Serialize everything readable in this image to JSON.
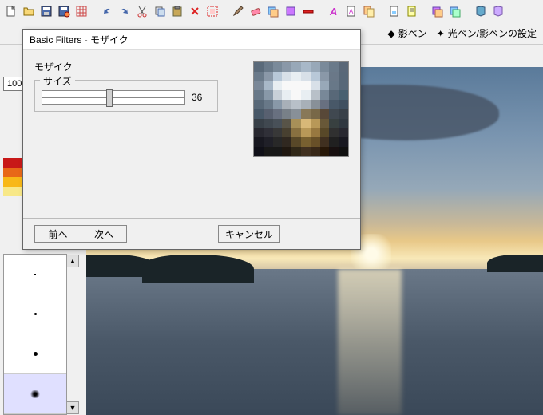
{
  "toolbar": {
    "icons": [
      "new",
      "open",
      "save",
      "save-as",
      "grid",
      "undo",
      "redo",
      "cut",
      "copy",
      "paste",
      "delete",
      "select-all",
      "brush",
      "eraser",
      "layers",
      "pick",
      "opts",
      "text-a",
      "text-outline",
      "dup",
      "doc-a",
      "doc-b",
      "pal-a",
      "pal-b",
      "help",
      "about"
    ]
  },
  "subbar": {
    "shadow_pen": "影ペン",
    "light_pen": "光ペン/影ペンの設定"
  },
  "zoom": {
    "value": "100"
  },
  "palette": [
    "#c81818",
    "#e86818",
    "#f8b818",
    "#f8e888"
  ],
  "dialog": {
    "title": "Basic Filters - モザイク",
    "label": "モザイク",
    "size_label": "サイズ",
    "size_value": "36",
    "prev": "前へ",
    "next": "次へ",
    "cancel": "キャンセル"
  },
  "preview_pixels": [
    "#5a6a7a",
    "#6a7a8a",
    "#7a8a9a",
    "#8a98a8",
    "#98a8b8",
    "#a8b8c8",
    "#98a8b8",
    "#7a8a9a",
    "#6a7a8a",
    "#5a6878",
    "#6a7a8a",
    "#8a98a8",
    "#b8c8d8",
    "#d8e0e8",
    "#e8eef2",
    "#d8e0e8",
    "#b8c8d8",
    "#8a98a8",
    "#6a7888",
    "#586878",
    "#7a8898",
    "#a8b8c8",
    "#e8eef2",
    "#f8f8f8",
    "#f8f8f8",
    "#f8f8f8",
    "#d8e0e8",
    "#98a8b8",
    "#687888",
    "#586878",
    "#687888",
    "#8898a8",
    "#c8d0d8",
    "#e8eef2",
    "#f8f8f8",
    "#e8eef2",
    "#b8c0c8",
    "#788898",
    "#586878",
    "#486070",
    "#586878",
    "#687888",
    "#8898a8",
    "#a8b0b8",
    "#b8c0c8",
    "#a8b0b8",
    "#889098",
    "#687080",
    "#485868",
    "#405060",
    "#485868",
    "#586070",
    "#687080",
    "#788088",
    "#889098",
    "#887858",
    "#786848",
    "#584838",
    "#404850",
    "#384048",
    "#384048",
    "#404850",
    "#485058",
    "#585448",
    "#a89058",
    "#d8b878",
    "#b89858",
    "#685838",
    "#384040",
    "#303840",
    "#282830",
    "#303038",
    "#383838",
    "#484030",
    "#887040",
    "#b89858",
    "#987840",
    "#584828",
    "#303030",
    "#282830",
    "#181820",
    "#202028",
    "#282828",
    "#302820",
    "#584828",
    "#786030",
    "#685028",
    "#403020",
    "#202020",
    "#181820",
    "#101018",
    "#181818",
    "#181818",
    "#201810",
    "#302818",
    "#403020",
    "#382818",
    "#281808",
    "#181010",
    "#101010"
  ]
}
